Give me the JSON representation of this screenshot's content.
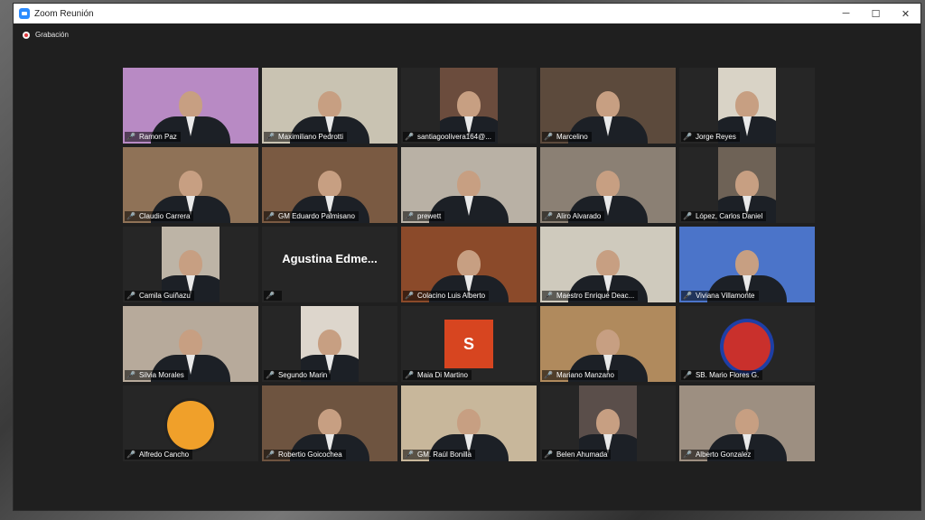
{
  "window": {
    "title": "Zoom Reunión",
    "minimize": "─",
    "maximize": "☐",
    "close": "✕"
  },
  "recording": {
    "label": "Grabación"
  },
  "participants": [
    {
      "name": "Ramon Paz",
      "bg": "#b88ac4"
    },
    {
      "name": "Maximiliano Pedrotti",
      "bg": "#c9c3b2"
    },
    {
      "name": "santiagoolivera164@...",
      "bg": "#6b4c3d"
    },
    {
      "name": "Marcelino",
      "bg": "#5c4a3c"
    },
    {
      "name": "Jorge Reyes",
      "bg": "#d9d3c6"
    },
    {
      "name": "Claudio Carrera",
      "bg": "#8f7257"
    },
    {
      "name": "GM Eduardo Palmisano",
      "bg": "#7a5a42"
    },
    {
      "name": "prewett",
      "bg": "#b9b1a5"
    },
    {
      "name": "Aliro Alvarado",
      "bg": "#8b8074"
    },
    {
      "name": "López, Carlos Daniel",
      "bg": "#6e6256"
    },
    {
      "name": "Camila Guiñazu",
      "bg": "#bdb4a6"
    },
    {
      "name": "Agustina Edme...",
      "bg": "#262626"
    },
    {
      "name": "Colacino Luis Alberto",
      "bg": "#8b4a2a"
    },
    {
      "name": "Maestro Enrique Deac...",
      "bg": "#cfcabd"
    },
    {
      "name": "Viviana Villamonte",
      "bg": "#4b74c9"
    },
    {
      "name": "Silvia Morales",
      "bg": "#b7aa9b"
    },
    {
      "name": "Segundo Marin",
      "bg": "#ddd6cc"
    },
    {
      "name": "Maia Di Martino",
      "bg": "#262626"
    },
    {
      "name": "Mariano Manzano",
      "bg": "#b08a5d"
    },
    {
      "name": "SB. Mario Flores G.",
      "bg": "#ffffff"
    },
    {
      "name": "Alfredo Cancho",
      "bg": "#ffffff"
    },
    {
      "name": "Robertio Goicochea",
      "bg": "#6e5440"
    },
    {
      "name": "GM. Raúl Bonilla",
      "bg": "#c8b79b"
    },
    {
      "name": "Belen Ahumada",
      "bg": "#5a4e4a"
    },
    {
      "name": "Alberto Gonzalez",
      "bg": "#9d8f81"
    }
  ],
  "agustina_display": "Agustina  Edme...",
  "maia_avatar": "S",
  "active_speaker_index": 7,
  "colors": {
    "accent_zoom": "#2d8cff",
    "active_border": "#c9e28c",
    "muted": "#e5433f",
    "avatar_s": "#d74520"
  }
}
